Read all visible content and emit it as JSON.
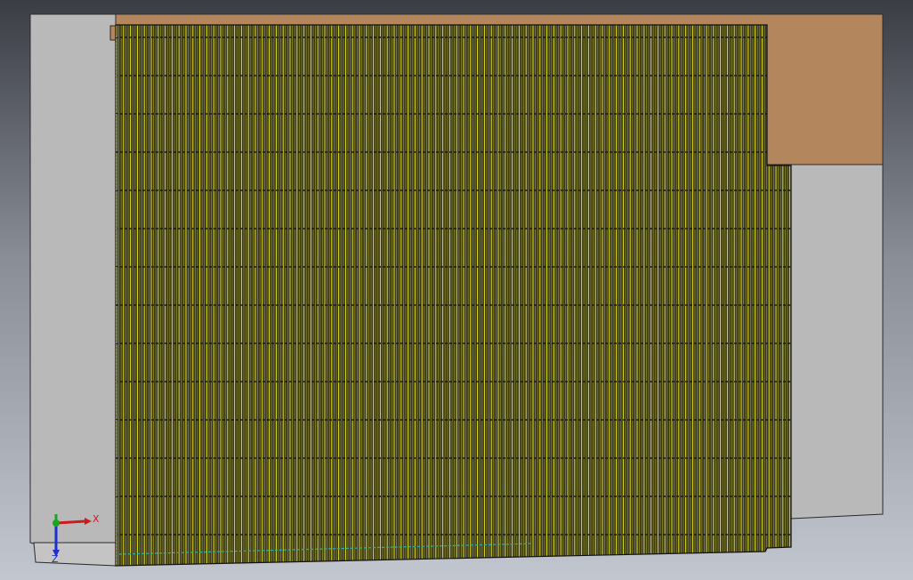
{
  "viewport": {
    "background_top": "#3a3d44",
    "background_bottom": "#c2c6cf"
  },
  "model": {
    "wall_color": "#b9b9b9",
    "wall_shadow": "#9c9c9c",
    "roof_color": "#b4865e",
    "panel_color": "#3b3a20",
    "stripe_bright": "#e3e01c",
    "stripe_dim": "#8c8a24",
    "rail_color": "#1a1a10",
    "ground_line_color": "#2ab3a7"
  },
  "triad": {
    "x_label": "X",
    "y_label": "Y",
    "z_label": "Z",
    "x_color": "#d0191f",
    "y_color": "#1aa51e",
    "z_color": "#1b2fd1"
  }
}
